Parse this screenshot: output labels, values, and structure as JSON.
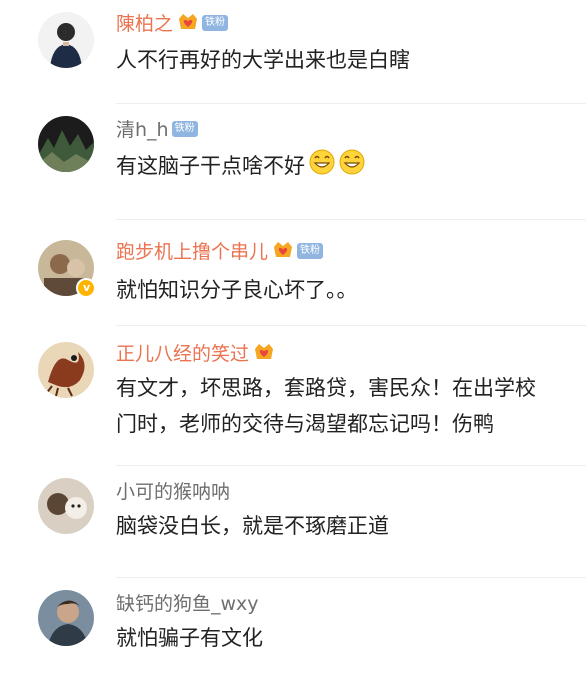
{
  "comments": [
    {
      "username": "陳柏之",
      "text": "人不行再好的大学出来也是白瞎",
      "fan_badge": "铁粉"
    },
    {
      "username": "清h_h",
      "text": "有这脑子干点啥不好",
      "fan_badge": "铁粉"
    },
    {
      "username": "跑步机上撸个串儿",
      "text": "就怕知识分子良心坏了。。",
      "fan_badge": "铁粉"
    },
    {
      "username": "正儿八经的笑过",
      "text": "有文才，坏思路，套路贷，害民众！在出学校门时，老师的交待与渴望都忘记吗！伤鸭"
    },
    {
      "username": "小可的猴呐呐",
      "text": "脑袋没白长，就是不琢磨正道"
    },
    {
      "username": "缺钙的狗鱼_wxy",
      "text": "就怕骗子有文化"
    }
  ],
  "colors": {
    "vip_name": "#eb7350",
    "normal_name": "#6f6f6f",
    "body_text": "#222222",
    "fan_badge_bg": "#8fb5e0",
    "crown_gold": "#f5a623"
  },
  "icons": {
    "crown": "crown-heart-icon",
    "grin": "grinning-face-icon",
    "verified": "verified-v-icon"
  }
}
